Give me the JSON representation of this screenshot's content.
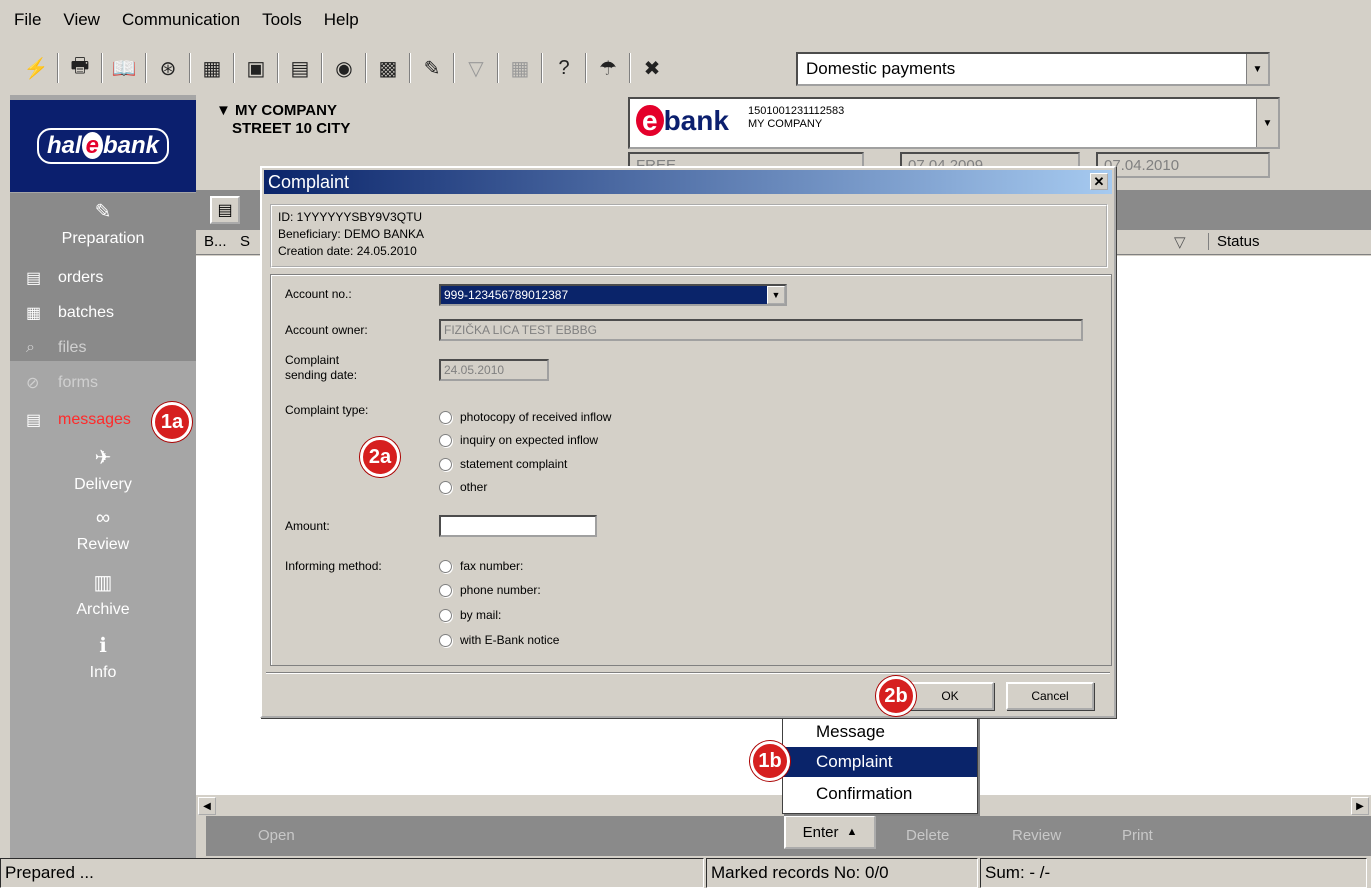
{
  "menu": [
    "File",
    "View",
    "Communication",
    "Tools",
    "Help"
  ],
  "toolbar": {
    "icons": [
      "lightning-icon",
      "printer-icon",
      "book-icon",
      "globe-icon",
      "binary-icon",
      "building-icon",
      "form-icon",
      "money-icon",
      "drum-icon",
      "edit-icon",
      "filter-icon",
      "calculator-icon",
      "help-icon",
      "lock-icon",
      "close-icon"
    ],
    "glyphs": [
      "⚡",
      "🖶",
      "📖",
      "⊛",
      "▦",
      "▣",
      "▤",
      "◉",
      "▩",
      "✎",
      "▽",
      "▦",
      "?",
      "☂",
      "✖"
    ],
    "payment_type": "Domestic payments"
  },
  "sidebar": {
    "logo_pre": "hal",
    "logo_e": "e",
    "logo_post": "bank",
    "preparation": "Preparation",
    "items": [
      {
        "label": "orders",
        "state": "normal"
      },
      {
        "label": "batches",
        "state": "normal"
      },
      {
        "label": "files",
        "state": "dim"
      },
      {
        "label": "forms",
        "state": "dim"
      },
      {
        "label": "messages",
        "state": "active"
      }
    ],
    "sections": [
      "Delivery",
      "Review",
      "Archive",
      "Info"
    ]
  },
  "company": {
    "name": "MY COMPANY",
    "address": "STREET 10 CITY"
  },
  "ebank": {
    "logo_e": "e",
    "logo_text": "bank",
    "account": "1501001231112583",
    "owner": "MY COMPANY"
  },
  "filters": {
    "status": "FREE",
    "date_from": "07.04.2009",
    "date_to": "07.04.2010"
  },
  "columns": {
    "b": "B...",
    "s": "S",
    "sort": "▽",
    "status": "Status"
  },
  "actions": {
    "open": "Open",
    "enter": "Enter",
    "delete": "Delete",
    "review": "Review",
    "print": "Print"
  },
  "statusbar": {
    "left": "Prepared ...",
    "marked": "Marked records No: 0/0",
    "sum": "Sum: - /-"
  },
  "popup": {
    "items": [
      "Message",
      "Complaint",
      "Confirmation"
    ],
    "selected": "Complaint"
  },
  "dialog": {
    "title": "Complaint",
    "id_line": "ID: 1YYYYYYSBY9V3QTU",
    "beneficiary": "Beneficiary: DEMO BANKA",
    "creation": "Creation date: 24.05.2010",
    "account_label": "Account no.:",
    "account_value": "999-123456789012387",
    "owner_label": "Account owner:",
    "owner_value": "FIZIČKA LICA TEST EBBBG",
    "sending_label_1": "Complaint",
    "sending_label_2": "sending date:",
    "sending_value": "24.05.2010",
    "type_label": "Complaint type:",
    "types": [
      "photocopy of received inflow",
      "inquiry on expected inflow",
      "statement complaint",
      "other"
    ],
    "amount_label": "Amount:",
    "amount_value": "",
    "inform_label": "Informing method:",
    "informs": [
      "fax number:",
      "phone number:",
      "by mail:",
      "with E-Bank notice"
    ],
    "ok": "OK",
    "cancel": "Cancel"
  },
  "badges": {
    "b1a": "1a",
    "b1b": "1b",
    "b2a": "2a",
    "b2b": "2b"
  },
  "colors": {
    "selection": "#0a246a",
    "brand": "#0b1f6e",
    "accent_red": "#e4002b",
    "badge": "#d61f1f"
  }
}
